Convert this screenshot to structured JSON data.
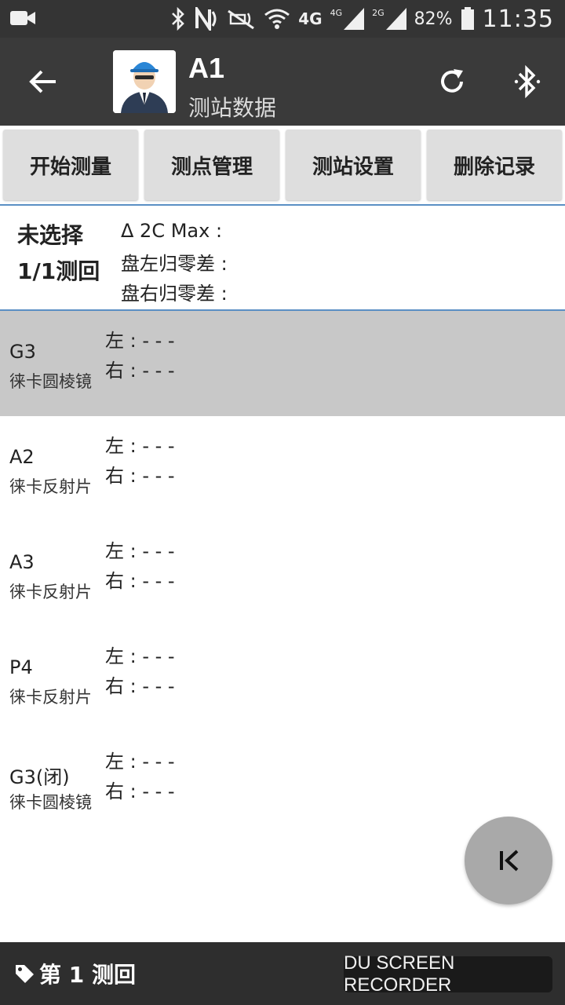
{
  "status_bar": {
    "network_4g": "4G",
    "signal_4g": "4G",
    "signal_2g": "2G",
    "battery": "82%",
    "time": "11:35",
    "icons": [
      "video-camera-icon",
      "bluetooth-icon",
      "nfc-icon",
      "mute-icon",
      "wifi-icon",
      "signal-icon",
      "battery-icon"
    ]
  },
  "app_bar": {
    "title": "A1",
    "subtitle": "测站数据",
    "icons": [
      "back-arrow-icon",
      "avatar-icon",
      "refresh-icon",
      "bluetooth-icon"
    ]
  },
  "toolbar": {
    "buttons": [
      "开始测量",
      "测点管理",
      "测站设置",
      "删除记录"
    ]
  },
  "summary": {
    "selection_status": "未选择",
    "round": "1/1测回",
    "lines": [
      "Δ 2C  Max :",
      "盘左归零差 :",
      "盘右归零差 :"
    ]
  },
  "points": [
    {
      "name": "G3",
      "type": "徕卡圆棱镜",
      "left": "左 :  -   -   -",
      "right": "右 :  -   -   -",
      "selected": true
    },
    {
      "name": "A2",
      "type": "徕卡反射片",
      "left": "左 :  -   -   -",
      "right": "右 :  -   -   -",
      "selected": false
    },
    {
      "name": "A3",
      "type": "徕卡反射片",
      "left": "左 :  -   -   -",
      "right": "右 :  -   -   -",
      "selected": false
    },
    {
      "name": "P4",
      "type": "徕卡反射片",
      "left": "左 :  -   -   -",
      "right": "右 :  -   -   -",
      "selected": false
    },
    {
      "name": "G3(闭)",
      "type": "徕卡圆棱镜",
      "left": "左 :  -   -   -",
      "right": "右 :  -   -   -",
      "selected": false
    }
  ],
  "fab": {
    "icon": "first-page-icon"
  },
  "bottom_bar": {
    "round_label": "第 1 测回",
    "icon": "tag-icon",
    "watermark": "DU SCREEN RECORDER"
  },
  "colors": {
    "status_bar": "#343434",
    "app_bar": "#3a3a3a",
    "button": "#dedede",
    "divider": "#5a8fc4",
    "selected_row": "#c8c8c8",
    "fab": "#a9a9a9",
    "bottom_bar": "#2e2e2e"
  }
}
